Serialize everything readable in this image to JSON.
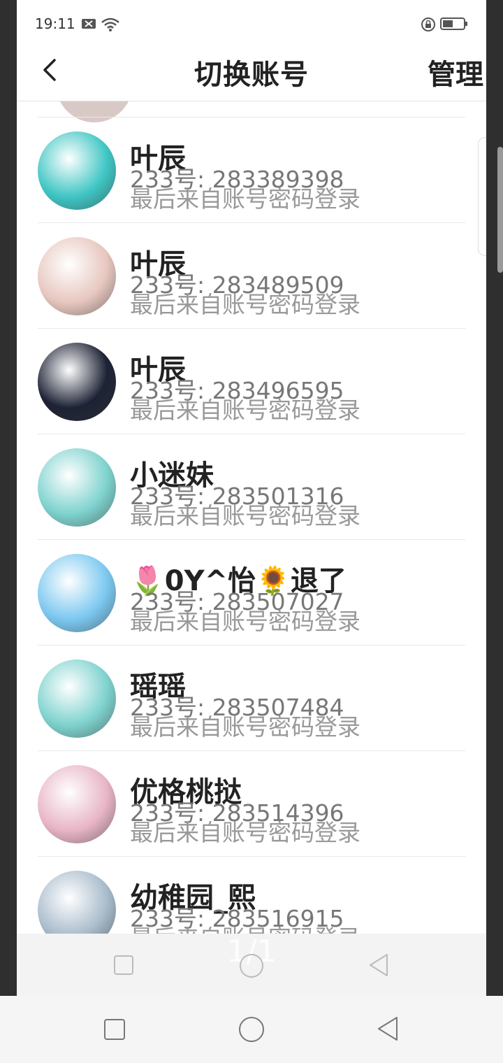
{
  "status": {
    "time": "19:11"
  },
  "header": {
    "title": "切换账号",
    "manage": "管理"
  },
  "accounts": [
    {
      "name": "叶辰",
      "uid": "233号: 283389398",
      "source": "最后来自账号密码登录",
      "avatar_color": "#3fc6c4"
    },
    {
      "name": "叶辰",
      "uid": "233号: 283489509",
      "source": "最后来自账号密码登录",
      "avatar_color": "#e7c7bf"
    },
    {
      "name": "叶辰",
      "uid": "233号: 283496595",
      "source": "最后来自账号密码登录",
      "avatar_color": "#1d2235"
    },
    {
      "name": "小迷妹",
      "uid": "233号: 283501316",
      "source": "最后来自账号密码登录",
      "avatar_color": "#7fd3cf"
    },
    {
      "name": "🌷0Y^怡🌻退了",
      "uid": "233号: 283507027",
      "source": "最后来自账号密码登录",
      "avatar_color": "#7cc8f0"
    },
    {
      "name": "瑶瑶",
      "uid": "233号: 283507484",
      "source": "最后来自账号密码登录",
      "avatar_color": "#7fd3cf"
    },
    {
      "name": "优格桃挞",
      "uid": "233号: 283514396",
      "source": "最后来自账号密码登录",
      "avatar_color": "#e8b5c6"
    },
    {
      "name": "幼稚园_熙",
      "uid": "233号: 283516915",
      "source": "最后来自账号密码登录",
      "avatar_color": "#a9bccc"
    }
  ],
  "pager": {
    "text": "1/1"
  }
}
